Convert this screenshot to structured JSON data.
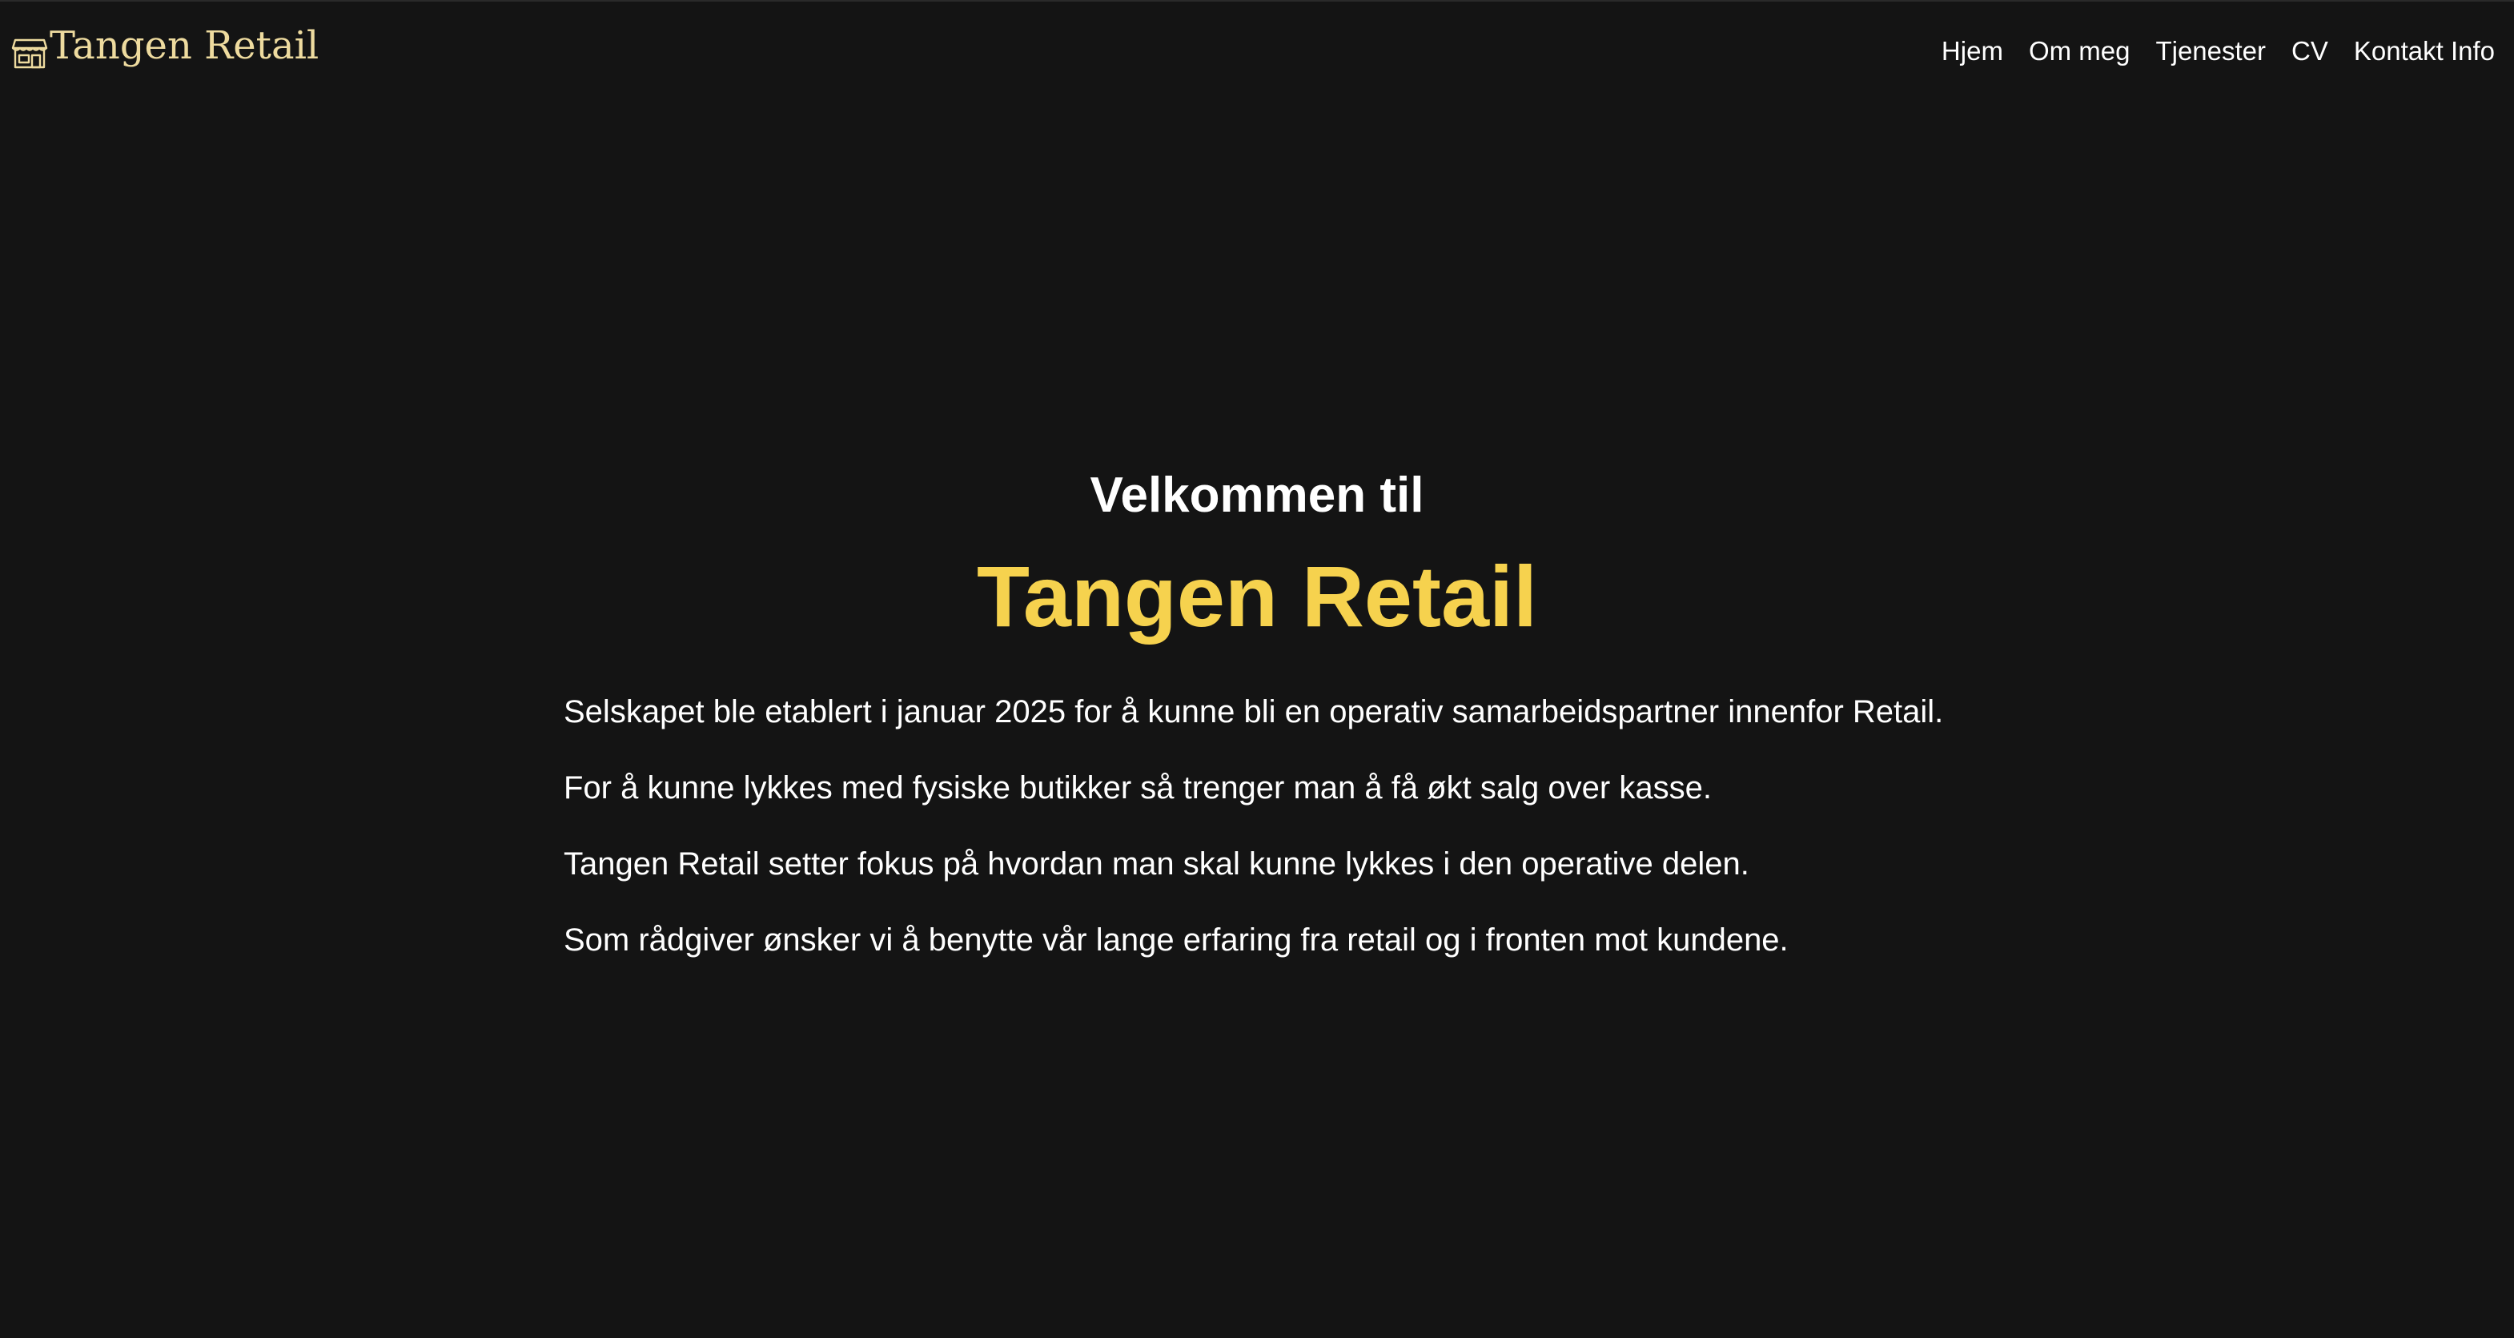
{
  "brand": {
    "name": "Tangen Retail",
    "icon": "storefront-icon",
    "color": "#eedb9f"
  },
  "nav": {
    "items": [
      {
        "label": "Hjem"
      },
      {
        "label": "Om meg"
      },
      {
        "label": "Tjenester"
      },
      {
        "label": "CV"
      },
      {
        "label": "Kontakt Info"
      }
    ]
  },
  "hero": {
    "kicker": "Velkommen til",
    "title": "Tangen Retail",
    "title_color": "#f6d24e",
    "paragraphs": [
      "Selskapet ble etablert i januar 2025 for å kunne bli en operativ samarbeidspartner innenfor Retail.",
      "For å kunne lykkes med fysiske butikker så trenger man å få økt salg over kasse.",
      "Tangen Retail setter fokus på hvordan man skal kunne lykkes i den operative delen.",
      "Som rådgiver ønsker vi å benytte vår lange erfaring fra retail og i fronten mot kundene."
    ]
  },
  "colors": {
    "background": "#141414",
    "text": "#ffffff"
  }
}
